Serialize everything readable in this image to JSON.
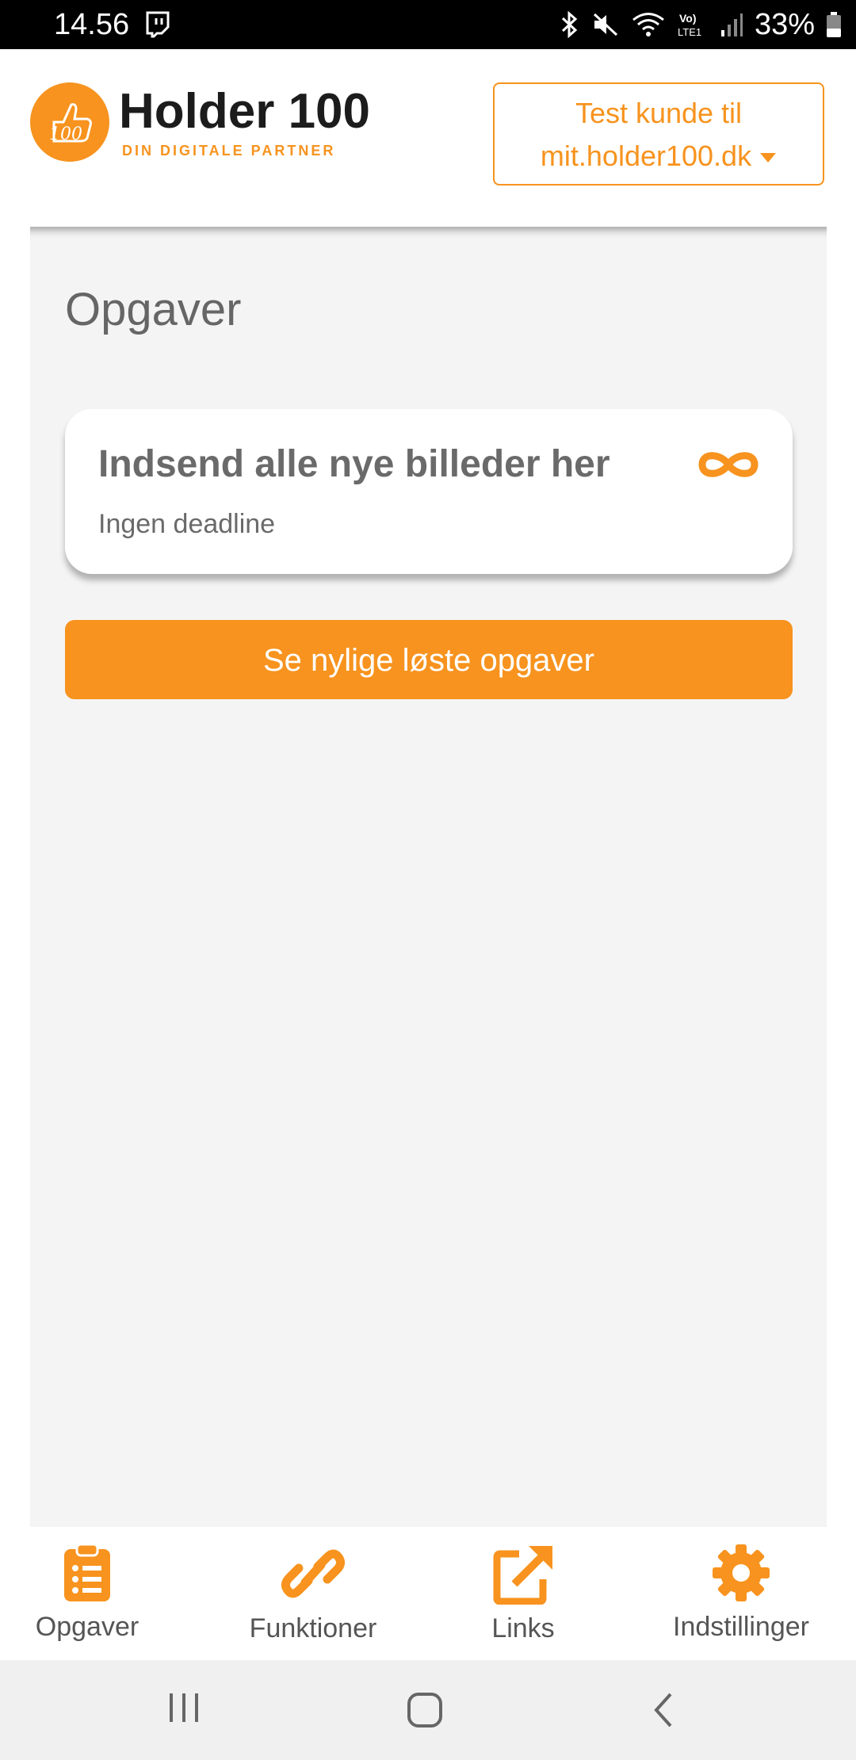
{
  "status_bar": {
    "time": "14.56",
    "battery": "33%",
    "icons": [
      "twitch-notification-icon",
      "bluetooth-icon",
      "mute-icon",
      "wifi-icon",
      "volte-icon",
      "signal-icon",
      "battery-icon"
    ]
  },
  "header": {
    "brand_name": "Holder 100",
    "brand_tagline": "DIN DIGITALE PARTNER",
    "customer_select": {
      "line1": "Test kunde til",
      "line2": "mit.holder100.dk"
    }
  },
  "main": {
    "title": "Opgaver",
    "tasks": [
      {
        "title": "Indsend alle nye billeder her",
        "deadline": "Ingen deadline",
        "icon": "infinity-icon"
      }
    ],
    "recent_button_label": "Se nylige løste opgaver"
  },
  "bottom_nav": {
    "items": [
      {
        "label": "Opgaver",
        "icon": "clipboard-list-icon"
      },
      {
        "label": "Funktioner",
        "icon": "link-icon"
      },
      {
        "label": "Links",
        "icon": "external-link-icon"
      },
      {
        "label": "Indstillinger",
        "icon": "gear-icon"
      }
    ]
  },
  "system_nav": [
    "recent-apps-icon",
    "home-icon",
    "back-icon"
  ],
  "colors": {
    "accent": "#f7931e",
    "background": "#f4f4f4",
    "text_muted": "#666666"
  }
}
